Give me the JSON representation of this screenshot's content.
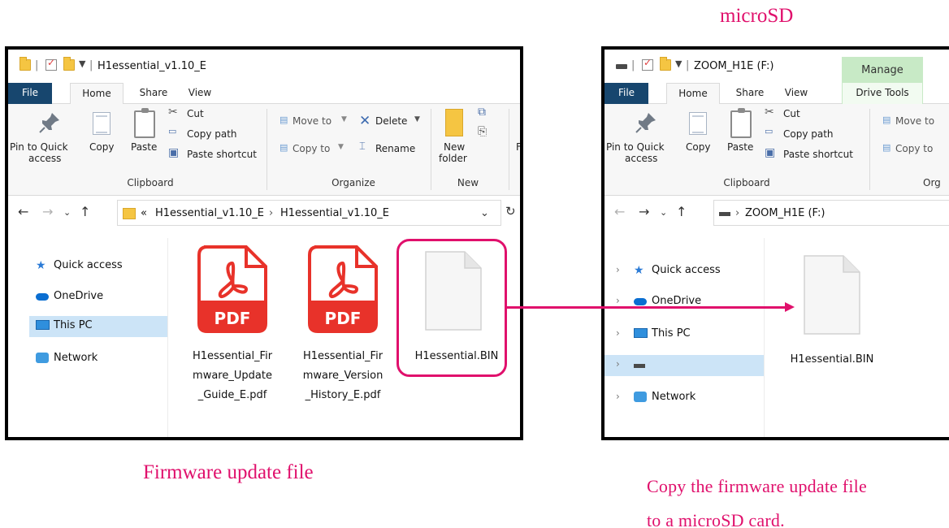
{
  "captions": {
    "microsd": "microSD",
    "left": "Firmware update file",
    "right_line1": "Copy the firmware update file",
    "right_line2": "to a microSD card."
  },
  "left_window": {
    "title": "H1essential_v1.10_E",
    "tabs": [
      "File",
      "Home",
      "Share",
      "View"
    ],
    "ribbon": {
      "pin": "Pin to Quick",
      "pin2": "access",
      "copy": "Copy",
      "paste": "Paste",
      "cut": "Cut",
      "copy_path": "Copy path",
      "paste_shortcut": "Paste shortcut",
      "move_to": "Move to",
      "copy_to": "Copy to",
      "delete": "Delete",
      "rename": "Rename",
      "new_folder": "New",
      "new_folder2": "folder",
      "clipboard": "Clipboard",
      "organize": "Organize",
      "new": "New",
      "cut_off": "F"
    },
    "address": {
      "chevron": "«",
      "part1": "H1essential_v1.10_E",
      "part2": "H1essential_v1.10_E"
    },
    "nav": [
      "Quick access",
      "OneDrive",
      "This PC",
      "Network"
    ],
    "files": [
      {
        "lines": [
          "H1essential_Fir",
          "mware_Update",
          "_Guide_E.pdf"
        ],
        "badge": "PDF"
      },
      {
        "lines": [
          "H1essential_Fir",
          "mware_Version",
          "_History_E.pdf"
        ],
        "badge": "PDF"
      },
      {
        "lines": [
          "H1essential.BIN"
        ]
      }
    ]
  },
  "right_window": {
    "title": "ZOOM_H1E (F:)",
    "manage": "Manage",
    "tabs": [
      "File",
      "Home",
      "Share",
      "View",
      "Drive Tools"
    ],
    "ribbon": {
      "pin": "Pin to Quick",
      "pin2": "access",
      "copy": "Copy",
      "paste": "Paste",
      "cut": "Cut",
      "copy_path": "Copy path",
      "paste_shortcut": "Paste shortcut",
      "move_to": "Move to",
      "copy_to": "Copy to",
      "clipboard": "Clipboard",
      "organize": "Org"
    },
    "address": {
      "part1": "ZOOM_H1E (F:)"
    },
    "nav": [
      "Quick access",
      "OneDrive",
      "This PC",
      "",
      "Network"
    ],
    "files": [
      {
        "lines": [
          "H1essential.BIN"
        ]
      }
    ]
  },
  "colors": {
    "accent": "#e0106c",
    "pdf_red": "#e8322a",
    "file_tab": "#17466e",
    "manage_tab": "#c8eac6"
  }
}
